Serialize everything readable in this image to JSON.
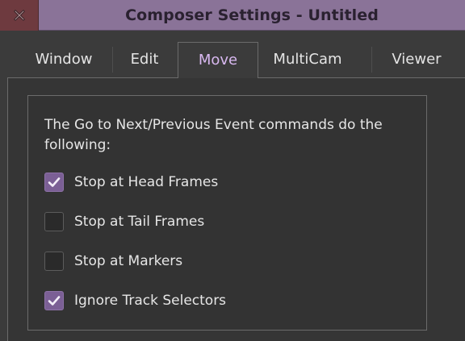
{
  "window": {
    "title": "Composer Settings - Untitled"
  },
  "tabs": [
    {
      "label": "Window",
      "active": false
    },
    {
      "label": "Edit",
      "active": false
    },
    {
      "label": "Move",
      "active": true
    },
    {
      "label": "MultiCam",
      "active": false
    },
    {
      "label": "Viewer",
      "active": false
    }
  ],
  "move": {
    "description": "The Go to Next/Previous Event commands do the following:",
    "options": [
      {
        "label": "Stop at Head Frames",
        "checked": true
      },
      {
        "label": "Stop at Tail Frames",
        "checked": false
      },
      {
        "label": "Stop at Markers",
        "checked": false
      },
      {
        "label": "Ignore Track Selectors",
        "checked": true
      }
    ]
  },
  "colors": {
    "titlebar": "#8a7398",
    "close_box": "#6e3a3f",
    "active_tab_text": "#d8b8f0",
    "checkbox_checked": "#7b5f95"
  },
  "icons": {
    "close": "close-icon",
    "check": "checkmark-icon"
  }
}
